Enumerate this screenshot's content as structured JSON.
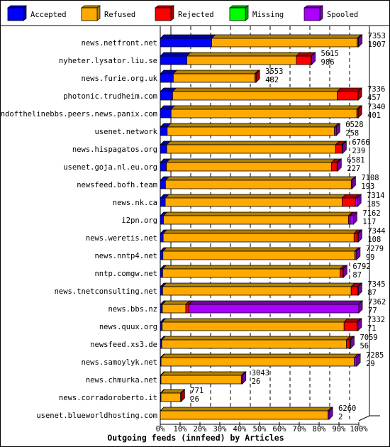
{
  "chart_data": {
    "type": "bar",
    "orientation": "horizontal",
    "stacked": true,
    "title": "Outgoing feeds (innfeed) by Articles",
    "xlim": [
      0,
      100
    ],
    "x_ticks": [
      "0%",
      "10%",
      "20%",
      "30%",
      "40%",
      "50%",
      "60%",
      "70%",
      "80%",
      "90%",
      "100%"
    ],
    "grid": true,
    "legend_placement": "top",
    "legend": [
      {
        "name": "Accepted",
        "color": "#0000ff",
        "dark": "#0000a8"
      },
      {
        "name": "Refused",
        "color": "#ffaa00",
        "dark": "#b08000"
      },
      {
        "name": "Rejected",
        "color": "#ff0000",
        "dark": "#aa0000"
      },
      {
        "name": "Missing",
        "color": "#00ff00",
        "dark": "#00a800"
      },
      {
        "name": "Spooled",
        "color": "#aa00ff",
        "dark": "#7700aa"
      }
    ],
    "categories": [
      "news.netfront.net",
      "nyheter.lysator.liu.se",
      "news.furie.org.uk",
      "photonic.trudheim.com",
      "endofthelinebbs.peers.news.panix.com",
      "usenet.network",
      "news.hispagatos.org",
      "usenet.goja.nl.eu.org",
      "newsfeed.bofh.team",
      "news.nk.ca",
      "i2pn.org",
      "news.weretis.net",
      "news.nntp4.net",
      "nntp.comgw.net",
      "news.tnetconsulting.net",
      "news.bbs.nz",
      "news.quux.org",
      "newsfeed.xs3.de",
      "news.samoylyk.net",
      "news.chmurka.net",
      "news.corradoroberto.it",
      "usenet.blueworldhosting.com"
    ],
    "offered": [
      7353,
      5615,
      3553,
      7336,
      7340,
      6528,
      6766,
      6581,
      7108,
      7314,
      7162,
      7344,
      7279,
      6792,
      7345,
      7362,
      7332,
      7059,
      7285,
      3043,
      771,
      6260
    ],
    "series": [
      {
        "name": "Accepted",
        "values": [
          1907,
          986,
          482,
          457,
          401,
          258,
          239,
          227,
          193,
          185,
          117,
          108,
          99,
          87,
          87,
          77,
          71,
          56,
          29,
          26,
          26,
          2
        ]
      },
      {
        "name": "Refused",
        "values": [
          5396,
          4060,
          3026,
          6109,
          6889,
          6202,
          6264,
          6128,
          6889,
          6559,
          6862,
          7078,
          7114,
          6584,
          6992,
          870,
          6745,
          6850,
          7167,
          2980,
          729,
          6221
        ]
      },
      {
        "name": "Rejected",
        "values": [
          0,
          545,
          45,
          770,
          50,
          0,
          237,
          200,
          0,
          490,
          63,
          116,
          0,
          95,
          237,
          113,
          484,
          121,
          0,
          0,
          16,
          0
        ]
      },
      {
        "name": "Missing",
        "values": [
          0,
          0,
          0,
          0,
          0,
          0,
          0,
          0,
          0,
          0,
          0,
          0,
          0,
          0,
          0,
          0,
          0,
          0,
          0,
          0,
          0,
          0
        ]
      },
      {
        "name": "Spooled",
        "values": [
          50,
          24,
          0,
          0,
          0,
          68,
          26,
          26,
          26,
          80,
          120,
          42,
          66,
          26,
          29,
          6302,
          32,
          32,
          89,
          37,
          0,
          37
        ]
      }
    ]
  }
}
